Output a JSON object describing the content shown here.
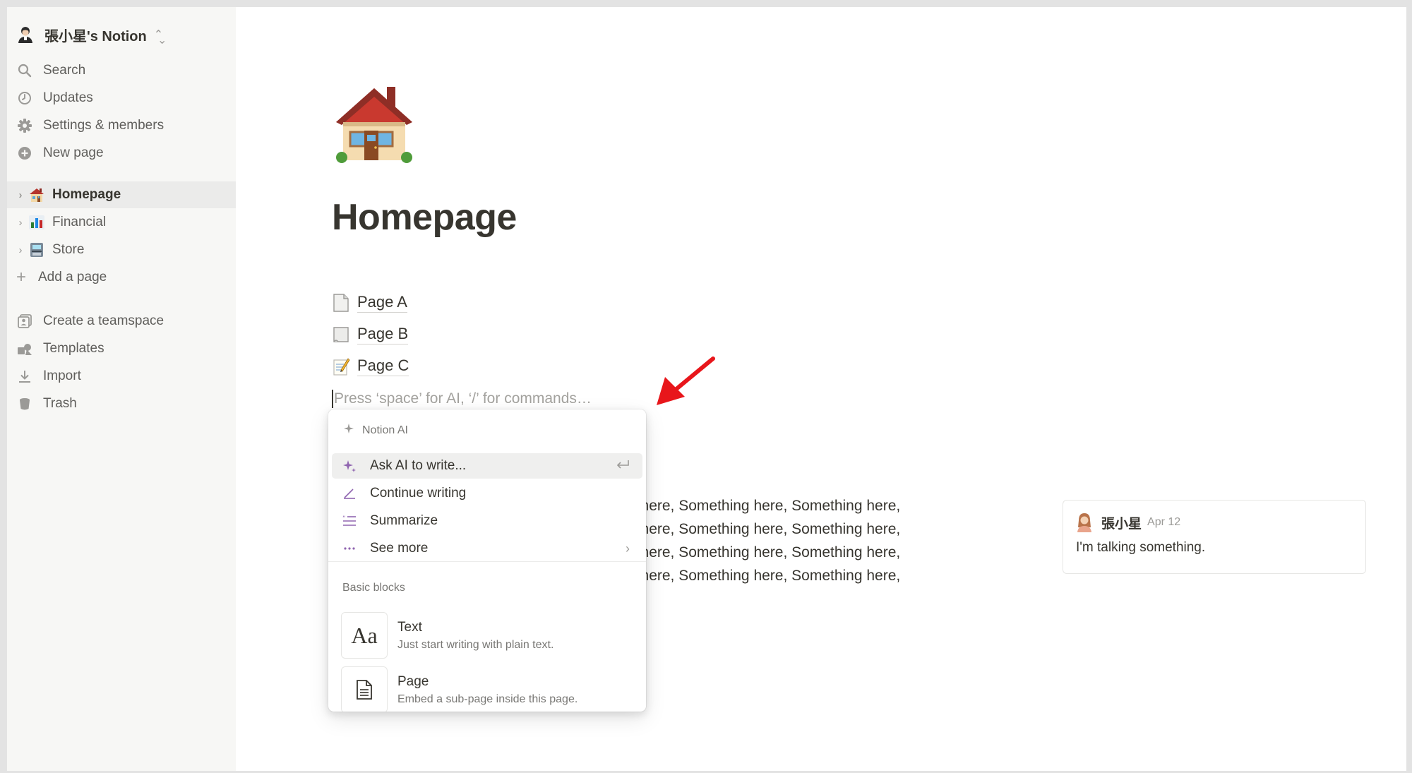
{
  "workspace": {
    "name": "張小星's Notion"
  },
  "sidebar": {
    "nav": [
      {
        "label": "Search",
        "icon": "search-icon"
      },
      {
        "label": "Updates",
        "icon": "clock-icon"
      },
      {
        "label": "Settings & members",
        "icon": "gear-icon"
      },
      {
        "label": "New page",
        "icon": "plus-circle-icon"
      }
    ],
    "pages": [
      {
        "label": "Homepage",
        "icon": "house-emoji",
        "active": true
      },
      {
        "label": "Financial",
        "icon": "bar-chart-emoji",
        "active": false
      },
      {
        "label": "Store",
        "icon": "atm-emoji",
        "active": false
      }
    ],
    "add_page": "Add a page",
    "tools": [
      {
        "label": "Create a teamspace",
        "icon": "teamspace-icon"
      },
      {
        "label": "Templates",
        "icon": "templates-icon"
      },
      {
        "label": "Import",
        "icon": "download-icon"
      },
      {
        "label": "Trash",
        "icon": "trash-icon"
      }
    ]
  },
  "page": {
    "icon": "house-emoji",
    "title": "Homepage",
    "subpages": [
      {
        "label": "Page A",
        "icon": "page-facing-up-emoji"
      },
      {
        "label": "Page B",
        "icon": "scroll-page-emoji"
      },
      {
        "label": "Page C",
        "icon": "memo-emoji"
      }
    ],
    "placeholder": "Press ‘space’ for AI, ‘/’ for commands…",
    "paragraph_lines": [
      "g here, Something here, Something here,",
      "g here, Something here, Something here,",
      "g here, Something here, Something here,",
      "g here, Something here, Something here,"
    ]
  },
  "comment": {
    "author": "張小星",
    "date": "Apr 12",
    "text": "I'm talking something."
  },
  "menu": {
    "ai_header": "Notion AI",
    "ai_items": [
      {
        "label": "Ask AI to write...",
        "icon": "sparkle-icon",
        "right": "enter-icon",
        "highlighted": true
      },
      {
        "label": "Continue writing",
        "icon": "pen-icon"
      },
      {
        "label": "Summarize",
        "icon": "summarize-icon"
      },
      {
        "label": "See more",
        "icon": "ellipsis-icon",
        "right": "chevron-right-icon"
      }
    ],
    "section_label": "Basic blocks",
    "blocks": [
      {
        "name": "Text",
        "desc": "Just start writing with plain text.",
        "glyph": "Aa"
      },
      {
        "name": "Page",
        "desc": "Embed a sub-page inside this page.",
        "glyph": "page-icon"
      }
    ]
  },
  "colors": {
    "sidebar_bg": "#f7f7f5",
    "active_row": "#ebebea",
    "text": "#37352f",
    "muted": "#9b9a97",
    "ai_purple": "#9065b0",
    "annotation_red": "#e8161b"
  }
}
